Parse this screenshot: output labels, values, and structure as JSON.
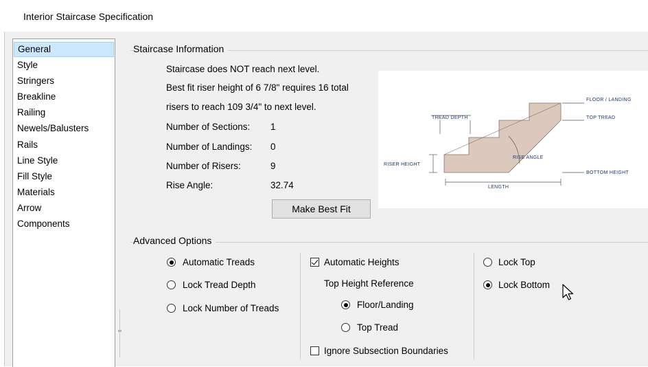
{
  "window": {
    "title": "Interior Staircase Specification"
  },
  "sidebar": {
    "items": [
      {
        "label": "General",
        "selected": true
      },
      {
        "label": "Style"
      },
      {
        "label": "Stringers"
      },
      {
        "label": "Breakline"
      },
      {
        "label": "Railing"
      },
      {
        "label": "Newels/Balusters"
      },
      {
        "label": "Rails"
      },
      {
        "label": "Line Style"
      },
      {
        "label": "Fill Style"
      },
      {
        "label": "Materials"
      },
      {
        "label": "Arrow"
      },
      {
        "label": "Components"
      }
    ]
  },
  "info": {
    "group_title": "Staircase Information",
    "line1": "Staircase does NOT reach next level.",
    "line2": "Best fit riser height of 6 7/8\" requires 16 total",
    "line3": "risers to reach 109 3/4\" to next level.",
    "sections_label": "Number of Sections:",
    "sections_value": "1",
    "landings_label": "Number of Landings:",
    "landings_value": "0",
    "risers_label": "Number of Risers:",
    "risers_value": "9",
    "angle_label": "Rise Angle:",
    "angle_value": "32.74",
    "best_fit_button": "Make Best Fit"
  },
  "diagram": {
    "tread_depth": "TREAD DEPTH",
    "floor_landing": "FLOOR / LANDING",
    "top_tread": "TOP TREAD",
    "riser_height": "RISER HEIGHT",
    "rise_angle": "RISE ANGLE",
    "bottom_height": "BOTTOM HEIGHT",
    "length": "LENGTH",
    "stair_fill": "#dcc9be"
  },
  "advanced": {
    "group_title": "Advanced Options",
    "automatic_treads": "Automatic Treads",
    "lock_tread_depth": "Lock Tread Depth",
    "lock_number_treads": "Lock Number of Treads",
    "automatic_heights": "Automatic Heights",
    "top_height_reference": "Top Height Reference",
    "floor_landing": "Floor/Landing",
    "top_tread": "Top Tread",
    "ignore_subsection": "Ignore Subsection Boundaries",
    "lock_top": "Lock Top",
    "lock_bottom": "Lock Bottom"
  }
}
